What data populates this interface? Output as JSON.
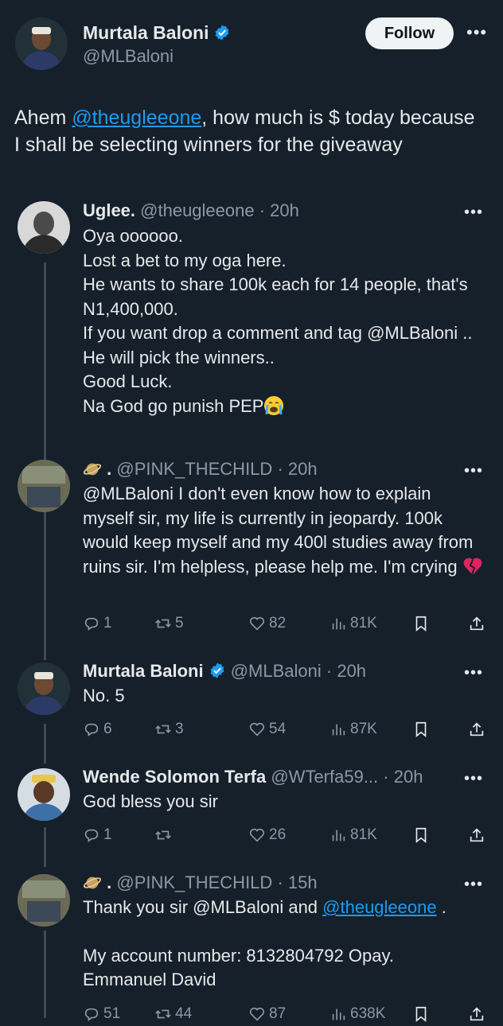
{
  "main_tweet": {
    "name": "Murtala Baloni",
    "handle": "@MLBaloni",
    "follow_label": "Follow",
    "text_pre": "Ahem ",
    "mention": "@theugleeone",
    "text_post": ", how much is $ today because I shall be selecting winners for the giveaway"
  },
  "quoted": {
    "name": "Uglee.",
    "handle": "@theugleeone",
    "time": "· 20h",
    "lines": [
      "Oya oooooo.",
      "Lost a bet to my oga here.",
      "He wants to share 100k each for 14 people, that's N1,400,000.",
      "If you want drop a comment and tag @MLBaloni ..",
      "He will pick the winners..",
      "Good Luck.",
      "Na God go punish PEP"
    ]
  },
  "reply1": {
    "name": ".",
    "handle": "@PINK_THECHILD",
    "time": "· 20h",
    "text": "@MLBaloni I don't even know how to explain myself sir, my life is currently in jeopardy. 100k would keep myself and my 400l studies away from ruins sir. I'm helpless, please help me. I'm crying",
    "replies": "1",
    "reposts": "5",
    "likes": "82",
    "views": "81K"
  },
  "reply2": {
    "name": "Murtala Baloni",
    "handle": "@MLBaloni",
    "time": "· 20h",
    "text": "No. 5",
    "replies": "6",
    "reposts": "3",
    "likes": "54",
    "views": "87K"
  },
  "reply3": {
    "name": "Wende Solomon Terfa",
    "handle": "@WTerfa59...",
    "time": "· 20h",
    "text": "God bless you sir",
    "replies": "1",
    "reposts": "",
    "likes": "26",
    "views": "81K"
  },
  "reply4": {
    "name": ".",
    "handle": "@PINK_THECHILD",
    "time": "· 15h",
    "text_pre": "Thank you sir @MLBaloni and ",
    "mention": "@theugleeone",
    "text_post": " .",
    "line2": "My account number: 8132804792 Opay.",
    "line3": "Emmanuel David",
    "replies": "51",
    "reposts": "44",
    "likes": "87",
    "views": "638K"
  },
  "colors": {
    "background": "#15202b",
    "text": "#e7e9ea",
    "muted": "#8b98a5",
    "link": "#1d9bf0",
    "verified": "#1d9bf0",
    "heartbreak": "#e0245e"
  }
}
